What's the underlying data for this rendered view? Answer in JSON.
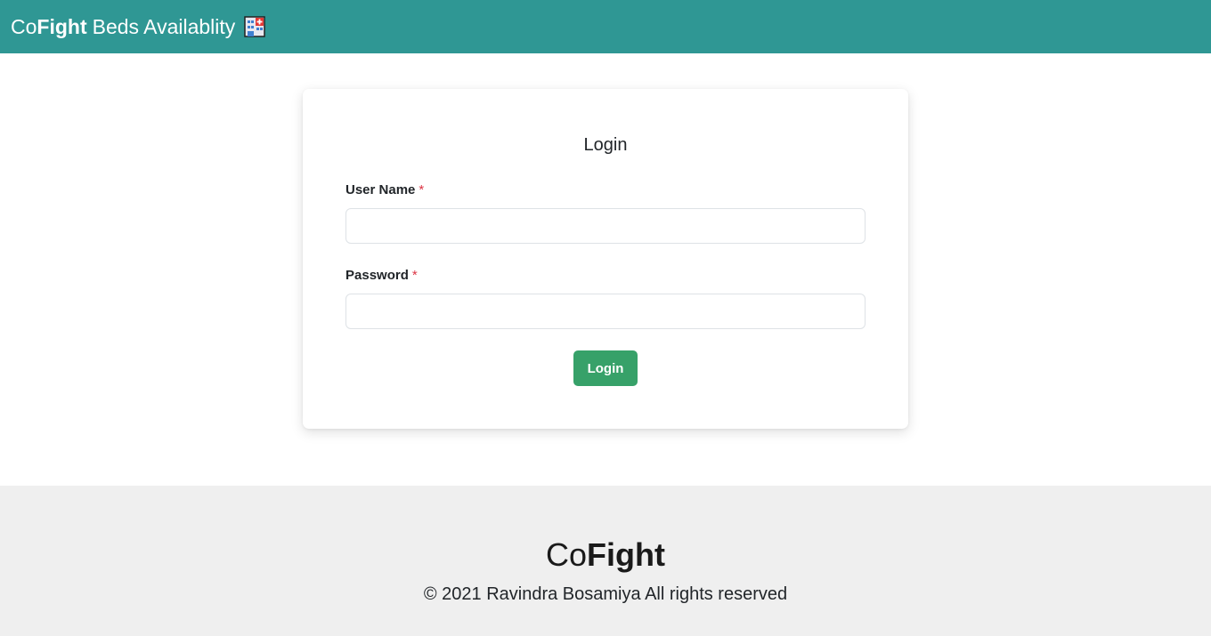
{
  "navbar": {
    "brand_prefix": "Co",
    "brand_bold": "Fight",
    "brand_rest": "Beds Availablity",
    "brand_icon": "hospital-icon"
  },
  "login_card": {
    "title": "Login",
    "username_label": "User Name",
    "username_required": "*",
    "username_value": "",
    "password_label": "Password",
    "password_required": "*",
    "password_value": "",
    "submit_label": "Login"
  },
  "footer": {
    "brand_prefix": "Co",
    "brand_bold": "Fight",
    "copyright": "© 2021 Ravindra Bosamiya All rights reserved"
  },
  "colors": {
    "navbar_bg": "#2f9794",
    "button_bg": "#37a169",
    "footer_bg": "#efefef",
    "required_mark": "#dc3545"
  }
}
